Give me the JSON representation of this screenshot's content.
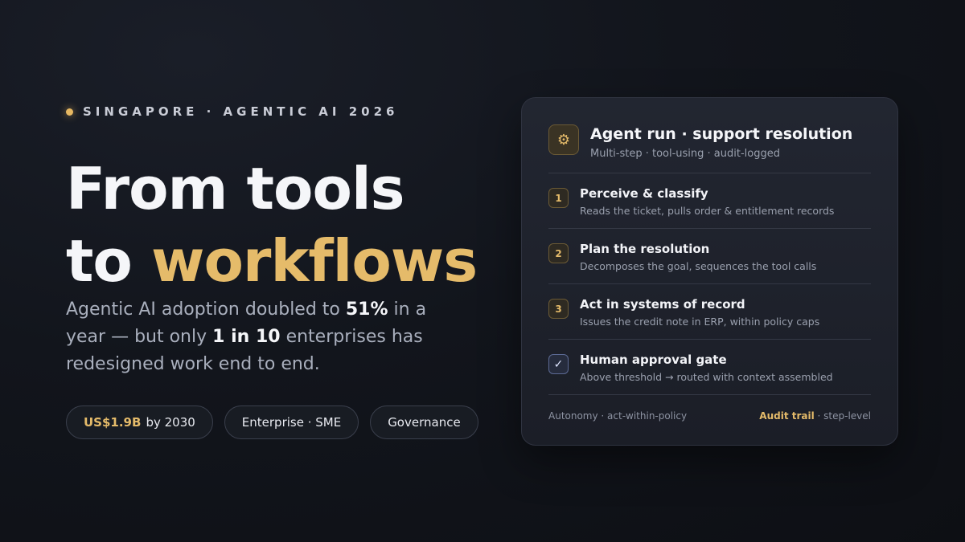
{
  "eyebrow": "SINGAPORE · AGENTIC AI 2026",
  "headline": {
    "line1": "From tools",
    "line2_prefix": "to ",
    "line2_accent": "workflows"
  },
  "lede": {
    "p1": "Agentic AI adoption doubled to ",
    "b1": "51%",
    "p2": " in a year — but only ",
    "b2": "1 in 10",
    "p3": " enterprises has redesigned work end to end."
  },
  "pills": [
    {
      "highlight": "US$1.9B",
      "label": "by 2030"
    },
    {
      "label": "Enterprise · SME"
    },
    {
      "label": "Governance"
    }
  ],
  "card": {
    "title": "Agent run · support resolution",
    "subtitle": "Multi-step · tool-using · audit-logged",
    "gear_icon": "⚙",
    "steps": [
      {
        "badge": "1",
        "title": "Perceive & classify",
        "desc": "Reads the ticket, pulls order & entitlement records"
      },
      {
        "badge": "2",
        "title": "Plan the resolution",
        "desc": "Decomposes the goal, sequences the tool calls"
      },
      {
        "badge": "3",
        "title": "Act in systems of record",
        "desc": "Issues the credit note in ERP, within policy caps"
      },
      {
        "badge": "✓",
        "title": "Human approval gate",
        "desc": "Above threshold → routed with context assembled"
      }
    ],
    "footer": {
      "left": "Autonomy · act-within-policy",
      "right_highlight": "Audit trail",
      "right_rest": " · step-level"
    }
  },
  "colors": {
    "accent": "#e5bb6a",
    "background": "#12151c",
    "card": "#1e212b"
  }
}
